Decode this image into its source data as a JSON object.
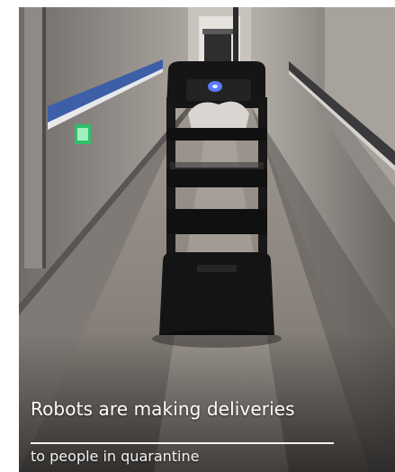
{
  "caption": {
    "title": "Robots are making deliveries",
    "subtitle": "to people in quarantine"
  },
  "colors": {
    "caption_text": "#ffffff",
    "rule": "#f2f2f2",
    "robot_body": "#141414",
    "robot_light": "#5b7cff",
    "exit_sign": "#2fbf6b",
    "handrail": "#3d5fa8"
  }
}
